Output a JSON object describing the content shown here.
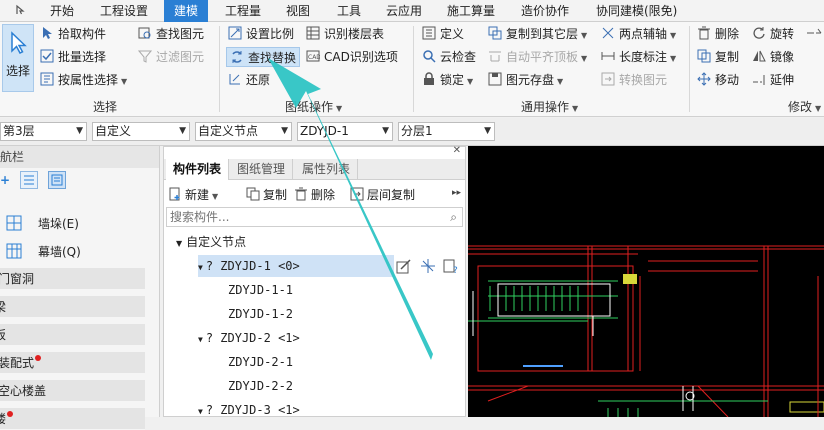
{
  "menu": {
    "items": [
      "开始",
      "工程设置",
      "建模",
      "工程量",
      "视图",
      "工具",
      "云应用",
      "施工算量",
      "造价协作",
      "协同建模(限免)"
    ],
    "active": "建模"
  },
  "ribbon": {
    "select_label": "选择",
    "select_group": {
      "pick_component": "拾取构件",
      "batch_select": "批量选择",
      "select_by_attr": "按属性选择",
      "find_element": "查找图元",
      "filter_element": "过滤图元",
      "group_label": "选择"
    },
    "drawing_group": {
      "set_scale": "设置比例",
      "find_replace": "查找替换",
      "restore": "还原",
      "identify_floor_table": "识别楼层表",
      "cad_identify_options": "CAD识别选项",
      "group_label": "图纸操作"
    },
    "general_group": {
      "define": "定义",
      "cloud_check": "云检查",
      "lock": "锁定",
      "copy_to_other_floor": "复制到其它层",
      "auto_level_top": "自动平齐顶板",
      "element_save": "图元存盘",
      "two_point_axis": "两点辅轴",
      "length_dimension": "长度标注",
      "convert_element": "转换图元",
      "group_label": "通用操作"
    },
    "modify_group": {
      "delete": "删除",
      "copy": "复制",
      "move": "移动",
      "rotate": "旋转",
      "mirror": "镜像",
      "extend": "延伸",
      "group_label": "修改"
    }
  },
  "combobar": {
    "floor": "第3层",
    "category": "自定义",
    "type": "自定义节点",
    "component": "ZDYJD-1",
    "layer": "分层1"
  },
  "leftnav": {
    "title": "导航栏",
    "leaves": [
      "墙垛(E)",
      "幕墙(Q)"
    ],
    "sections": [
      "门窗洞",
      "梁",
      "板",
      "装配式",
      "空心楼盖",
      "楼"
    ]
  },
  "panel": {
    "tabs": [
      "构件列表",
      "图纸管理",
      "属性列表"
    ],
    "toolbar": {
      "new": "新建",
      "copy": "复制",
      "delete": "删除",
      "floor_copy": "层间复制"
    },
    "search_placeholder": "搜索构件...",
    "tree": {
      "root": "自定义节点",
      "groups": [
        {
          "label": "? ZDYJD-1 <0>",
          "children": [
            "ZDYJD-1-1",
            "ZDYJD-1-2"
          ]
        },
        {
          "label": "? ZDYJD-2 <1>",
          "children": [
            "ZDYJD-2-1",
            "ZDYJD-2-2"
          ]
        },
        {
          "label": "? ZDYJD-3 <1>",
          "children": []
        }
      ]
    }
  },
  "colors": {
    "accent": "#2a7fd4",
    "arrow": "#2ec4c4",
    "selection": "#cfe2f6",
    "canvas": "#000000"
  }
}
